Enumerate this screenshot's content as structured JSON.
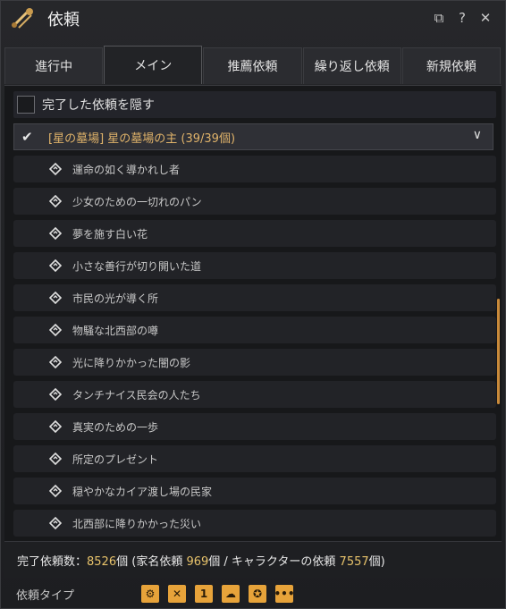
{
  "window": {
    "title": "依頼",
    "buttons": {
      "restore": "⧉",
      "help": "?",
      "close": "✕"
    }
  },
  "tabs": [
    {
      "label": "進行中",
      "active": false
    },
    {
      "label": "メイン",
      "active": true
    },
    {
      "label": "推薦依頼",
      "active": false
    },
    {
      "label": "繰り返し依頼",
      "active": false
    },
    {
      "label": "新規依頼",
      "active": false
    }
  ],
  "filter": {
    "hide_completed_label": "完了した依頼を隠す"
  },
  "group": {
    "label": "[星の墓場] 星の墓場の主 (39/39個)"
  },
  "quests": [
    "運命の如く導かれし者",
    "少女のための一切れのパン",
    "夢を施す白い花",
    "小さな善行が切り開いた道",
    "市民の光が導く所",
    "物騒な北西部の噂",
    "光に降りかかった闇の影",
    "タンチナイス民会の人たち",
    "真実のための一歩",
    "所定のプレゼント",
    "穏やかなカイア渡し場の民家",
    "北西部に降りかかった災い"
  ],
  "footer": {
    "prefix": "完了依頼数：",
    "total": "8526",
    "unit1": "個 (家名依頼 ",
    "family": "969",
    "unit2": "個 / キャラクターの依頼 ",
    "character": "7557",
    "unit3": "個)"
  },
  "type_bar": {
    "label": "依頼タイプ",
    "icons": [
      "combat-icon",
      "swords-icon",
      "one-icon",
      "chat-icon",
      "wheel-icon",
      "more-icon"
    ],
    "glyphs": [
      "⚙",
      "✕",
      "1",
      "☁",
      "✪",
      "•••"
    ]
  },
  "colors": {
    "accent": "#e7a33a",
    "group_text": "#e0b36a",
    "number": "#e8c36b"
  }
}
